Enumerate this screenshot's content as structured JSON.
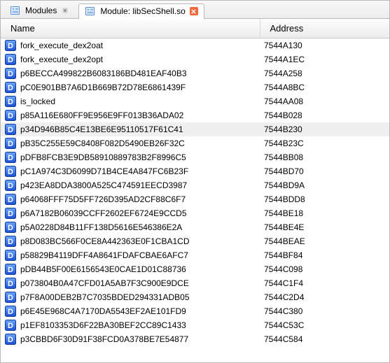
{
  "tabs": [
    {
      "label": "Modules",
      "active": false,
      "close_style": "gray"
    },
    {
      "label": "Module: libSecShell.so",
      "active": true,
      "close_style": "red"
    }
  ],
  "columns": {
    "name": "Name",
    "address": "Address"
  },
  "icon": {
    "letter": "D"
  },
  "selected_index": 6,
  "rows": [
    {
      "name": "fork_execute_dex2oat",
      "address": "7544A130"
    },
    {
      "name": "fork_execute_dex2opt",
      "address": "7544A1EC"
    },
    {
      "name": "p6BECCA499822B6083186BD481EAF40B3",
      "address": "7544A258"
    },
    {
      "name": "pC0E901BB7A6D1B669B72D78E6861439F",
      "address": "7544A8BC"
    },
    {
      "name": "is_locked",
      "address": "7544AA08"
    },
    {
      "name": "p85A116E680FF9E956E9FF013B36ADA02",
      "address": "7544B028"
    },
    {
      "name": "p34D946B85C4E13BE6E95110517F61C41",
      "address": "7544B230"
    },
    {
      "name": "pB35C255E59C8408F082D5490EB26F32C",
      "address": "7544B23C"
    },
    {
      "name": "pDFB8FCB3E9DB58910889783B2F8996C5",
      "address": "7544BB08"
    },
    {
      "name": "pC1A974C3D6099D71B4CE4A847FC6B23F",
      "address": "7544BD70"
    },
    {
      "name": "p423EA8DDA3800A525C474591EECD3987",
      "address": "7544BD9A"
    },
    {
      "name": "p64068FFF75D5FF726D395AD2CF88C6F7",
      "address": "7544BDD8"
    },
    {
      "name": "p6A7182B06039CCFF2602EF6724E9CCD5",
      "address": "7544BE18"
    },
    {
      "name": "p5A0228D84B11FF138D5616E546386E2A",
      "address": "7544BE4E"
    },
    {
      "name": "p8D083BC566F0CE8A442363E0F1CBA1CD",
      "address": "7544BEAE"
    },
    {
      "name": "p58829B4119DFF4A8641FDAFCBAE6AFC7",
      "address": "7544BF84"
    },
    {
      "name": "pDB44B5F00E6156543E0CAE1D01C88736",
      "address": "7544C098"
    },
    {
      "name": "p073804B0A47CFD01A5AB7F3C900E9DCE",
      "address": "7544C1F4"
    },
    {
      "name": "p7F8A00DEB2B7C7035BDED294331ADB05",
      "address": "7544C2D4"
    },
    {
      "name": "p6E45E968C4A7170DA5543EF2AE101FD9",
      "address": "7544C380"
    },
    {
      "name": "p1EF8103353D6F22BA30BEF2CC89C1433",
      "address": "7544C53C"
    },
    {
      "name": "p3CBBD6F30D91F38FCD0A378BE7E54877",
      "address": "7544C584"
    }
  ]
}
